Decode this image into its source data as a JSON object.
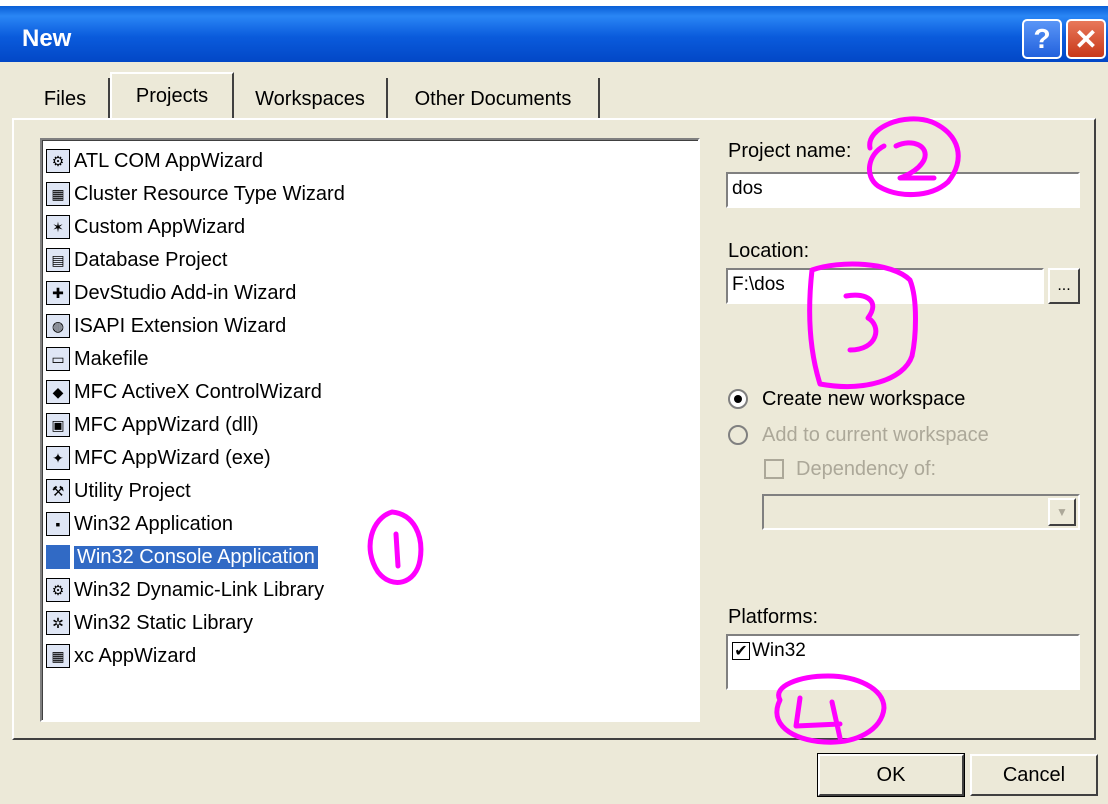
{
  "window": {
    "title": "New",
    "help_label": "?",
    "close_label": "✕"
  },
  "tabs": [
    {
      "label": "Files"
    },
    {
      "label": "Projects"
    },
    {
      "label": "Workspaces"
    },
    {
      "label": "Other Documents"
    }
  ],
  "project_list": {
    "selected": "Win32 Console Application",
    "items": [
      {
        "label": "ATL COM AppWizard",
        "icon": "atl-wizard-icon"
      },
      {
        "label": "Cluster Resource Type Wizard",
        "icon": "cluster-wizard-icon"
      },
      {
        "label": "Custom AppWizard",
        "icon": "custom-wizard-icon"
      },
      {
        "label": "Database Project",
        "icon": "database-icon"
      },
      {
        "label": "DevStudio Add-in Wizard",
        "icon": "addin-wizard-icon"
      },
      {
        "label": "ISAPI Extension Wizard",
        "icon": "globe-icon"
      },
      {
        "label": "Makefile",
        "icon": "makefile-icon"
      },
      {
        "label": "MFC ActiveX ControlWizard",
        "icon": "activex-icon"
      },
      {
        "label": "MFC AppWizard (dll)",
        "icon": "mfc-dll-icon"
      },
      {
        "label": "MFC AppWizard (exe)",
        "icon": "mfc-exe-icon"
      },
      {
        "label": "Utility Project",
        "icon": "tools-icon"
      },
      {
        "label": "Win32 Application",
        "icon": "win32-app-icon"
      },
      {
        "label": "Win32 Console Application",
        "icon": "console-icon"
      },
      {
        "label": "Win32 Dynamic-Link Library",
        "icon": "dll-icon"
      },
      {
        "label": "Win32 Static Library",
        "icon": "static-lib-icon"
      },
      {
        "label": "xc AppWizard",
        "icon": "xc-wizard-icon"
      }
    ]
  },
  "project_name": {
    "label": "Project name:",
    "value": "dos"
  },
  "location": {
    "label": "Location:",
    "value": "F:\\dos",
    "browse_label": "..."
  },
  "workspace_options": {
    "create_label": "Create new workspace",
    "add_label": "Add to current workspace",
    "dependency_label": "Dependency of:",
    "create_selected": true
  },
  "platforms": {
    "label": "Platforms:",
    "items": [
      {
        "label": "Win32",
        "checked": true
      }
    ]
  },
  "buttons": {
    "ok": "OK",
    "cancel": "Cancel"
  },
  "annotations": {
    "color": "#ff00ff",
    "marks": [
      "1",
      "2",
      "3",
      "4"
    ]
  },
  "colors": {
    "titlebar": "#0a5bdc",
    "selection": "#316ac5",
    "dialog_bg": "#ece9d8"
  }
}
